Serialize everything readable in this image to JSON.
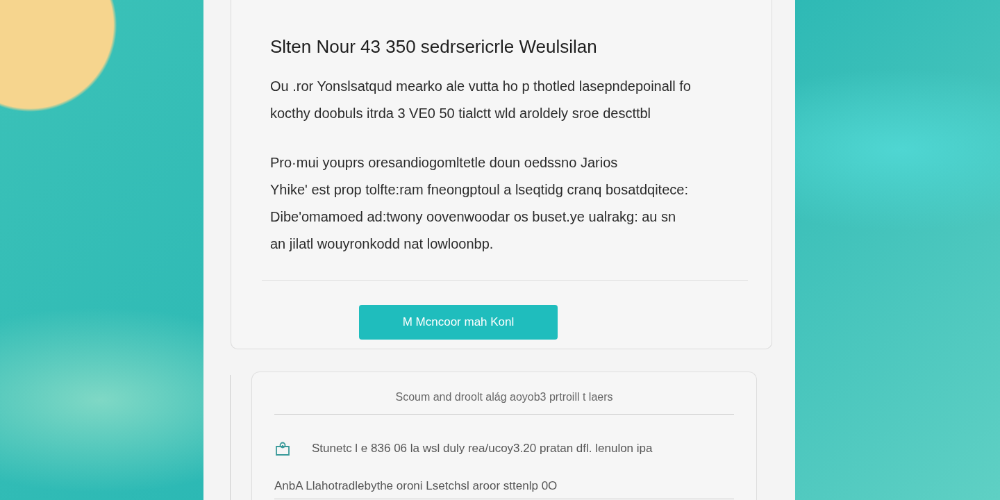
{
  "main_card": {
    "title": "Slten Nour 43 350 sedrsericrle Weulsilan",
    "paragraphs": [
      {
        "lines": [
          "Ou .ror Yonslsatqud mearko ale vutta ho p thotled lasepndepoinall fo",
          "kocthy doobuls itrda  3 VE0 50  tialctt wld aroldely sroe descttbl"
        ]
      },
      {
        "lines": [
          "Pro·mui youprs oresandiogomltetle doun oedssno Jarios",
          "Yhike' est prop tolfte:ram fneongptoul a lseqtidg cranq bosatdqitece:",
          "Dibe'omamoed ad:twony oovenwoodar os buset.ye ualrakg: au sn",
          "an jilatl wouyronkodd nat lowloonbp."
        ]
      }
    ],
    "button": "M Mcncoor mah Konl"
  },
  "lower_card": {
    "caption": "Scoum and droolt  alág aoyob3 prtroill t laers",
    "items": [
      {
        "kind": "icon_row",
        "text": "Stunetc l e 836 06  la wsl duly rea/ucoy3.20 pratan dfl. lenulon ipa"
      },
      {
        "kind": "plain",
        "text": "AnbA Llahotradlebythe oroni  Lsetchsl aroor sttenlp 0O"
      }
    ]
  }
}
